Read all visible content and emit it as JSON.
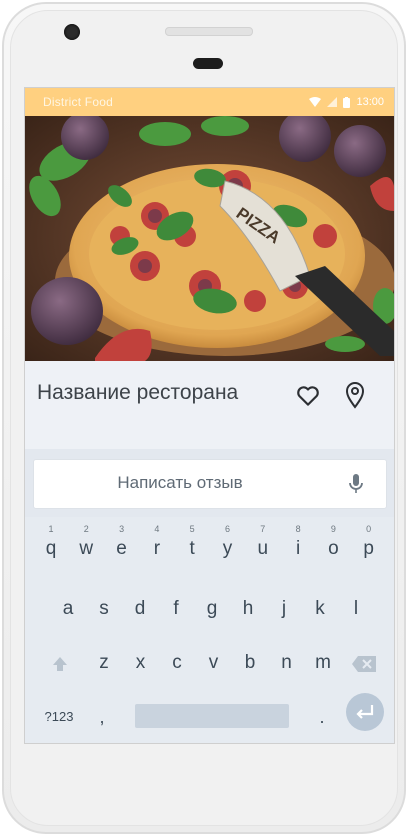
{
  "status_bar": {
    "app_name": "District  Food",
    "time": "13:00",
    "colors": {
      "background": "#ffd080"
    }
  },
  "hero": {
    "sign_text": "PIZZA",
    "image": "pizza-with-figs-photo"
  },
  "restaurant": {
    "name": "Название ресторана"
  },
  "icons": {
    "favorite": "heart-icon",
    "location": "map-pin-icon",
    "voice": "microphone-icon"
  },
  "review": {
    "placeholder": "Написать отзыв"
  },
  "keyboard": {
    "row1": [
      {
        "k": "q",
        "n": "1"
      },
      {
        "k": "w",
        "n": "2"
      },
      {
        "k": "e",
        "n": "3"
      },
      {
        "k": "r",
        "n": "4"
      },
      {
        "k": "t",
        "n": "5"
      },
      {
        "k": "y",
        "n": "6"
      },
      {
        "k": "u",
        "n": "7"
      },
      {
        "k": "i",
        "n": "8"
      },
      {
        "k": "o",
        "n": "9"
      },
      {
        "k": "p",
        "n": "0"
      }
    ],
    "row2": [
      "a",
      "s",
      "d",
      "f",
      "g",
      "h",
      "j",
      "k",
      "l"
    ],
    "row3": [
      "z",
      "x",
      "c",
      "v",
      "b",
      "n",
      "m"
    ],
    "symbols_label": "?123",
    "comma": ",",
    "period": "."
  }
}
